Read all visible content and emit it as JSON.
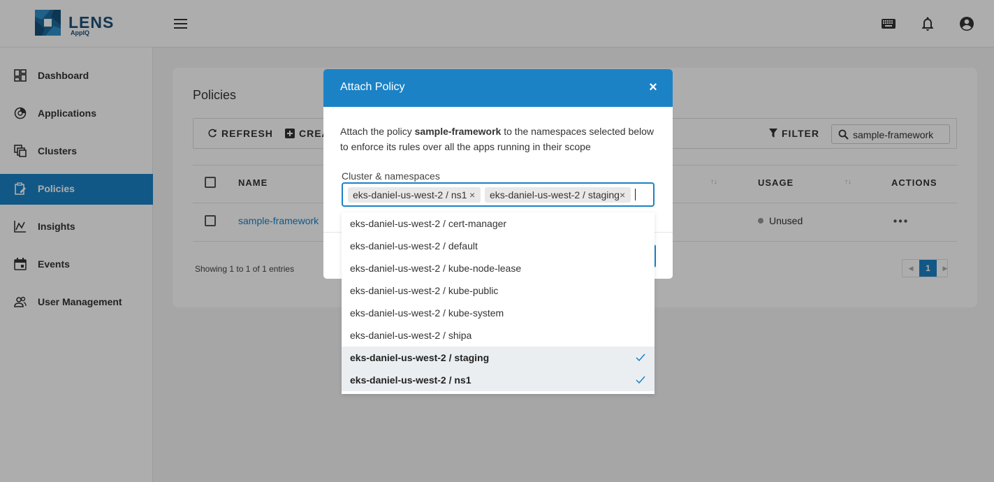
{
  "header": {
    "logo_text": "LENS",
    "logo_sub": "AppIQ"
  },
  "sidebar": {
    "items": [
      {
        "label": "Dashboard",
        "icon": "dashboard-icon"
      },
      {
        "label": "Applications",
        "icon": "applications-icon"
      },
      {
        "label": "Clusters",
        "icon": "clusters-icon"
      },
      {
        "label": "Policies",
        "icon": "policies-icon",
        "active": true
      },
      {
        "label": "Insights",
        "icon": "insights-icon"
      },
      {
        "label": "Events",
        "icon": "events-icon"
      },
      {
        "label": "User Management",
        "icon": "user-management-icon"
      }
    ]
  },
  "page": {
    "title": "Policies",
    "toolbar": {
      "refresh_label": "REFRESH",
      "create_label": "CREA",
      "filter_label": "FILTER",
      "search_value": "sample-framework"
    },
    "table": {
      "columns": [
        "NAME",
        "USAGE",
        "ACTIONS"
      ],
      "rows": [
        {
          "name": "sample-framework",
          "usage": "Unused"
        }
      ]
    },
    "showing_text": "Showing 1 to 1 of 1 entries",
    "pagination": {
      "current": "1"
    }
  },
  "modal": {
    "title": "Attach Policy",
    "close_glyph": "×",
    "description": {
      "prefix": "Attach the policy ",
      "policy_name": "sample-framework",
      "suffix": " to the namespaces selected below to enforce its rules over all the apps running in their scope"
    },
    "field_label": "Cluster & namespaces",
    "chips": [
      "eks-daniel-us-west-2 / ns1",
      "eks-daniel-us-west-2 / staging"
    ],
    "chip_remove_glyph": "×",
    "options": [
      {
        "label": "eks-daniel-us-west-2 / cert-manager",
        "selected": false
      },
      {
        "label": "eks-daniel-us-west-2 / default",
        "selected": false
      },
      {
        "label": "eks-daniel-us-west-2 / kube-node-lease",
        "selected": false
      },
      {
        "label": "eks-daniel-us-west-2 / kube-public",
        "selected": false
      },
      {
        "label": "eks-daniel-us-west-2 / kube-system",
        "selected": false
      },
      {
        "label": "eks-daniel-us-west-2 / shipa",
        "selected": false
      },
      {
        "label": "eks-daniel-us-west-2 / staging",
        "selected": true
      },
      {
        "label": "eks-daniel-us-west-2 / ns1",
        "selected": true
      }
    ]
  },
  "colors": {
    "accent": "#1b82c6",
    "check": "#1b82c6",
    "brand": "#1e5078"
  }
}
